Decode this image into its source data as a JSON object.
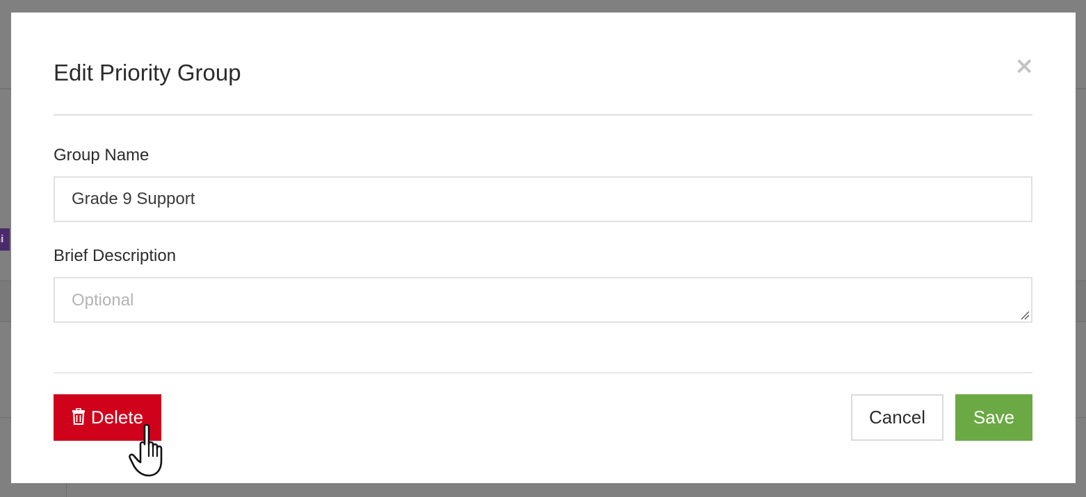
{
  "modal": {
    "title": "Edit Priority Group",
    "close_label": "×",
    "fields": {
      "group_name": {
        "label": "Group Name",
        "value": "Grade 9 Support"
      },
      "brief_description": {
        "label": "Brief Description",
        "value": "",
        "placeholder": "Optional"
      }
    },
    "buttons": {
      "delete_label": "Delete",
      "cancel_label": "Cancel",
      "save_label": "Save"
    }
  },
  "icons": {
    "close": "close-icon",
    "delete": "trash-icon",
    "cursor": "hand-pointer-icon",
    "resize": "resize-grip-icon"
  },
  "colors": {
    "delete": "#d0021b",
    "save": "#6aa943",
    "overlay": "#808080"
  }
}
